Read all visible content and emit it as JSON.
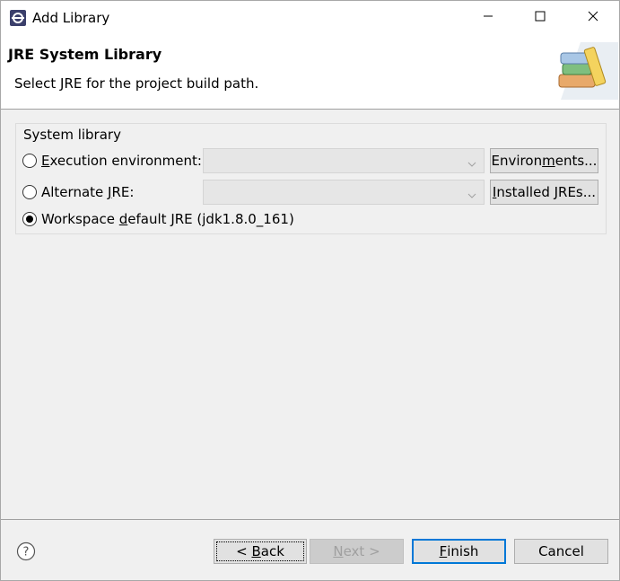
{
  "window": {
    "title": "Add Library",
    "icons": {
      "app": "eclipse-icon",
      "minimize": "minimize-icon",
      "maximize": "maximize-icon",
      "close": "close-icon"
    }
  },
  "banner": {
    "title": "JRE System Library",
    "description": "Select JRE for the project build path.",
    "image": "books-icon"
  },
  "system_library": {
    "group_label": "System library",
    "options": [
      {
        "label_pre": "",
        "mnemonic": "E",
        "label_post": "xecution environment:",
        "selected": false
      },
      {
        "label_pre": "Alternate ",
        "mnemonic": "J",
        "label_post": "RE:",
        "selected": false
      },
      {
        "label_pre": "Workspace ",
        "mnemonic": "d",
        "label_post": "efault JRE (jdk1.8.0_161)",
        "selected": true
      }
    ],
    "execution_env_value": "",
    "alternate_jre_value": "",
    "environments_button": {
      "pre": "Environ",
      "mnemonic": "m",
      "post": "ents..."
    },
    "installed_jres_button": {
      "pre": "",
      "mnemonic": "I",
      "post": "nstalled JREs..."
    }
  },
  "footer": {
    "help_icon": "help-icon",
    "back": {
      "pre": "< ",
      "mnemonic": "B",
      "post": "ack"
    },
    "next": {
      "pre": "",
      "mnemonic": "N",
      "post": "ext >"
    },
    "finish": {
      "pre": "",
      "mnemonic": "F",
      "post": "inish"
    },
    "cancel_label": "Cancel"
  },
  "colors": {
    "accent": "#0078d7",
    "dialog_bg": "#f0f0f0",
    "disabled_text": "#a0a0a0"
  }
}
